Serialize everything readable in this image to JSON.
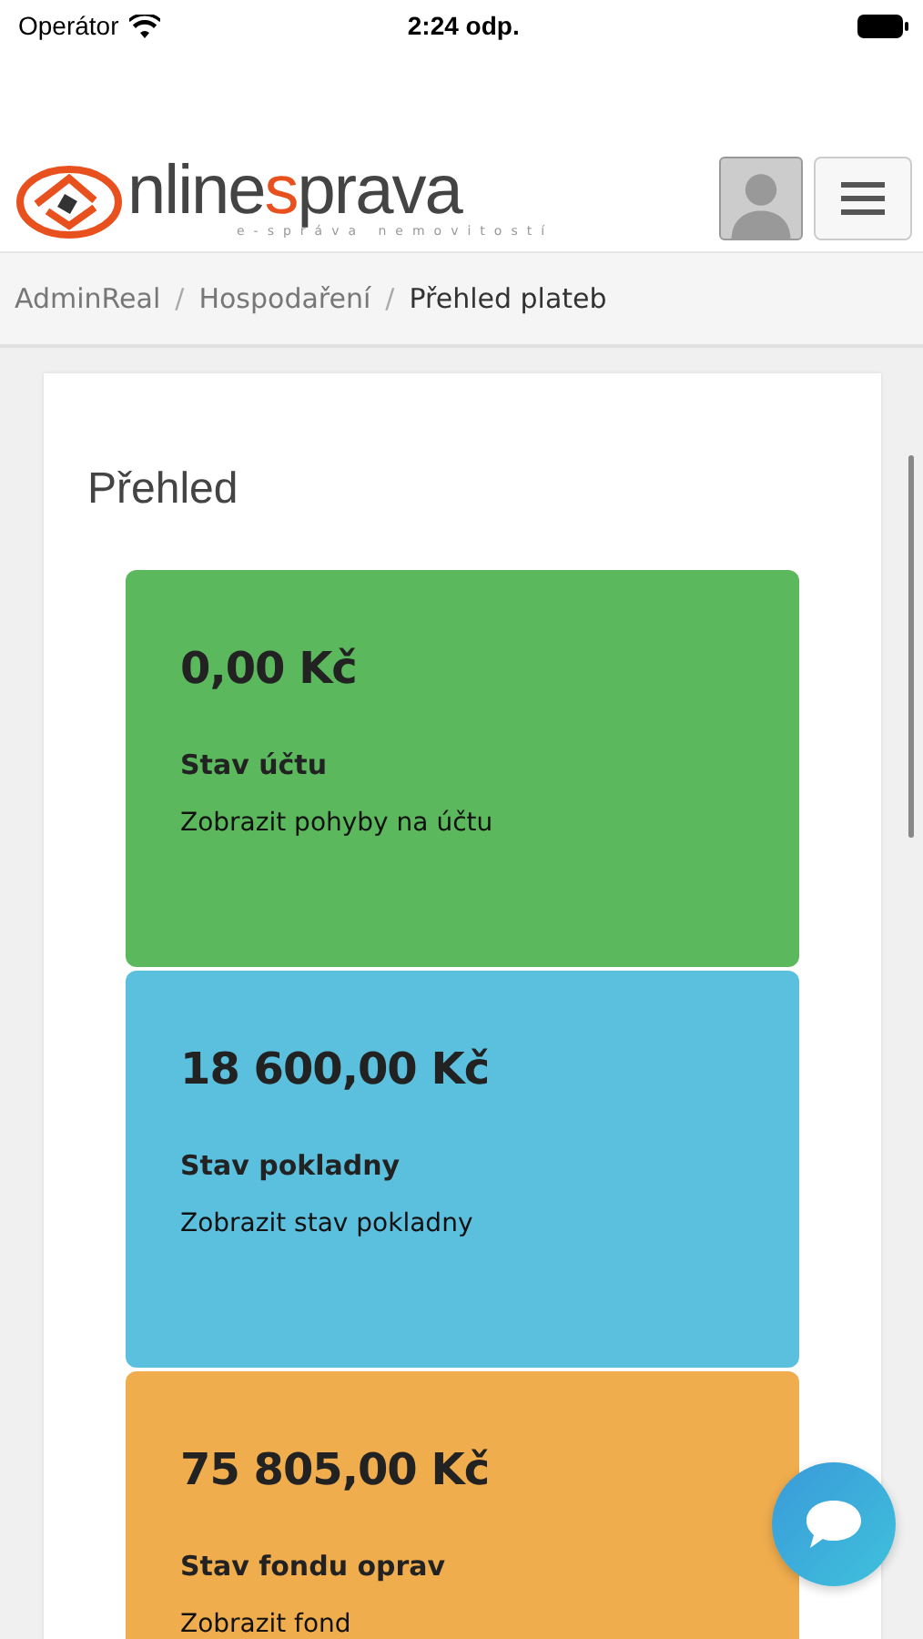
{
  "status_bar": {
    "carrier": "Operátor",
    "time": "2:24 odp."
  },
  "header": {
    "logo": {
      "parts": [
        {
          "text": "nline",
          "accent": false
        },
        {
          "text": "s",
          "accent": true
        },
        {
          "text": "prava",
          "accent": false
        }
      ],
      "tagline": "e-správa nemovitostí"
    }
  },
  "breadcrumb_separator": "/",
  "breadcrumb": [
    {
      "label": "AdminReal",
      "current": false
    },
    {
      "label": "Hospodaření",
      "current": false
    },
    {
      "label": "Přehled plateb",
      "current": true
    }
  ],
  "panel": {
    "title": "Přehled",
    "cards": [
      {
        "amount": "0,00 Kč",
        "label": "Stav účtu",
        "link": "Zobrazit pohyby na účtu",
        "color": "#5cb85c"
      },
      {
        "amount": "18 600,00 Kč",
        "label": "Stav pokladny",
        "link": "Zobrazit stav pokladny",
        "color": "#5bc0de"
      },
      {
        "amount": "75 805,00 Kč",
        "label": "Stav fondu oprav",
        "link": "Zobrazit fond",
        "color": "#f0ad4e"
      }
    ]
  }
}
